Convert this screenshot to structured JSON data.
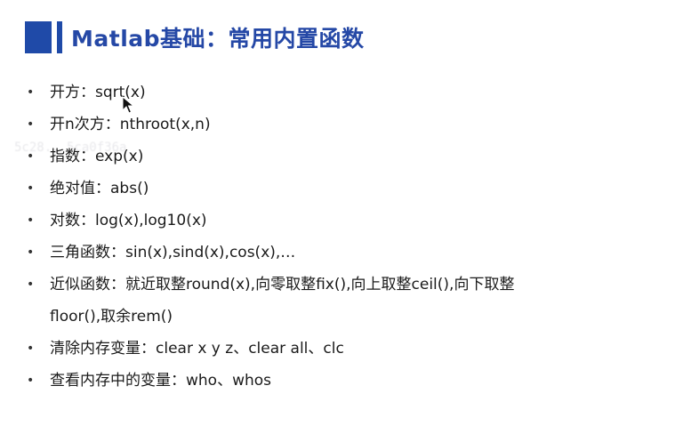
{
  "title": "Matlab基础：常用内置函数",
  "watermark": "5c28...5ca0f36a",
  "items": [
    {
      "text": "开方：sqrt(x)"
    },
    {
      "text": "开n次方：nthroot(x,n)"
    },
    {
      "text": "指数：exp(x)"
    },
    {
      "text": "绝对值：abs()"
    },
    {
      "text": "对数：log(x),log10(x)"
    },
    {
      "text": "三角函数：sin(x),sind(x),cos(x),…"
    },
    {
      "text": "近似函数：就近取整round(x),向零取整fix(),向上取整ceil(),向下取整",
      "cont": "floor(),取余rem()"
    },
    {
      "text": "清除内存变量：clear x y z、clear all、clc"
    },
    {
      "text": "查看内存中的变量：who、whos"
    }
  ],
  "bullet_glyph": "•",
  "colors": {
    "accent": "#1f4aa8",
    "title": "#2548a6",
    "text": "#1a1a1a"
  }
}
